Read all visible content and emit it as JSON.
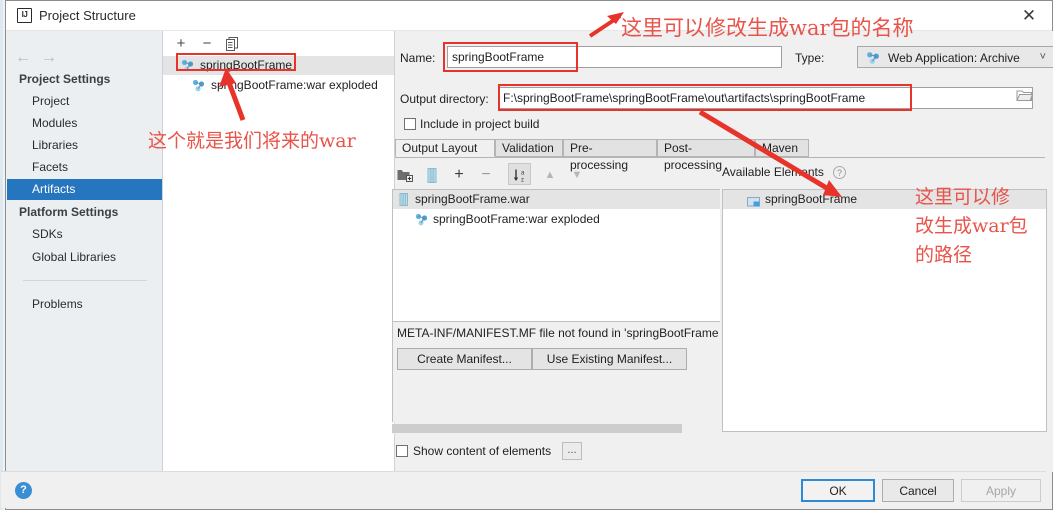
{
  "window": {
    "title": "Project Structure",
    "app_icon": "IJ",
    "close_icon": "close-icon"
  },
  "sidebar": {
    "nav_back": "←",
    "nav_forward": "→",
    "groups": [
      {
        "label": "Project Settings",
        "items": [
          {
            "label": "Project",
            "selected": false
          },
          {
            "label": "Modules",
            "selected": false
          },
          {
            "label": "Libraries",
            "selected": false
          },
          {
            "label": "Facets",
            "selected": false
          },
          {
            "label": "Artifacts",
            "selected": true
          }
        ]
      },
      {
        "label": "Platform Settings",
        "items": [
          {
            "label": "SDKs",
            "selected": false
          },
          {
            "label": "Global Libraries",
            "selected": false
          }
        ]
      }
    ],
    "extra_items": [
      {
        "label": "Problems",
        "selected": false
      }
    ]
  },
  "artifacts_panel": {
    "toolbar": [
      {
        "name": "add-artifact-button",
        "glyph": "+"
      },
      {
        "name": "remove-artifact-button",
        "glyph": "−"
      },
      {
        "name": "copy-artifact-button",
        "glyph": "❐"
      }
    ],
    "rows": [
      {
        "label": "springBootFrame",
        "selected": true,
        "child": false
      },
      {
        "label": "springBootFrame:war exploded",
        "selected": false,
        "child": true
      }
    ]
  },
  "form": {
    "name_label": "Name:",
    "name_value": "springBootFrame",
    "type_label": "Type:",
    "type_value": "Web Application: Archive",
    "output_dir_label": "Output directory:",
    "output_dir_value": "F:\\springBootFrame\\springBootFrame\\out\\artifacts\\springBootFrame",
    "include_in_build_label": "Include in project build",
    "include_in_build_checked": false
  },
  "tabs": [
    {
      "label": "Output Layout",
      "active": true
    },
    {
      "label": "Validation",
      "active": false
    },
    {
      "label": "Pre-processing",
      "active": false
    },
    {
      "label": "Post-processing",
      "active": false
    },
    {
      "label": "Maven",
      "active": false
    }
  ],
  "output_layout": {
    "toolbar": [
      {
        "name": "add-directory-button",
        "glyph": "dir"
      },
      {
        "name": "add-archive-button",
        "glyph": "arc"
      },
      {
        "name": "add-element-button",
        "glyph": "+"
      },
      {
        "name": "remove-element-button",
        "glyph": "−"
      },
      {
        "name": "sort-az-button",
        "glyph": "az"
      },
      {
        "name": "move-up-button",
        "glyph": "▲"
      },
      {
        "name": "move-down-button",
        "glyph": "▼"
      }
    ],
    "tree_rows": [
      {
        "label": "springBootFrame.war",
        "selected": true,
        "indent": 0,
        "icon": "archive-icon"
      },
      {
        "label": "springBootFrame:war exploded",
        "selected": false,
        "indent": 1,
        "icon": "artifact-icon"
      }
    ],
    "available_elements_label": "Available Elements",
    "available_help_glyph": "?",
    "available_rows": [
      {
        "label": "springBootFrame",
        "icon": "module-icon"
      }
    ],
    "manifest_message": "META-INF/MANIFEST.MF file not found in 'springBootFrame",
    "create_manifest_label": "Create Manifest...",
    "use_existing_manifest_label": "Use Existing Manifest...",
    "show_content_label": "Show content of elements",
    "show_content_checked": false,
    "dots_button_label": "..."
  },
  "bottom_bar": {
    "help_glyph": "?",
    "ok_label": "OK",
    "cancel_label": "Cancel",
    "apply_label": "Apply",
    "apply_disabled": true
  },
  "annotations": [
    {
      "id": "anno-name",
      "text": "这里可以修改生成war包的名称"
    },
    {
      "id": "anno-war",
      "text": "这个就是我们将来的war"
    },
    {
      "id": "anno-path-1",
      "text": "这里可以修"
    },
    {
      "id": "anno-path-2",
      "text": "改生成war包"
    },
    {
      "id": "anno-path-3",
      "text": "的路径"
    }
  ],
  "colors": {
    "annotation_red": "#e8534a",
    "box_red": "#e8332a",
    "selection_blue": "#2675bf",
    "accent_blue": "#3a8fd4"
  }
}
